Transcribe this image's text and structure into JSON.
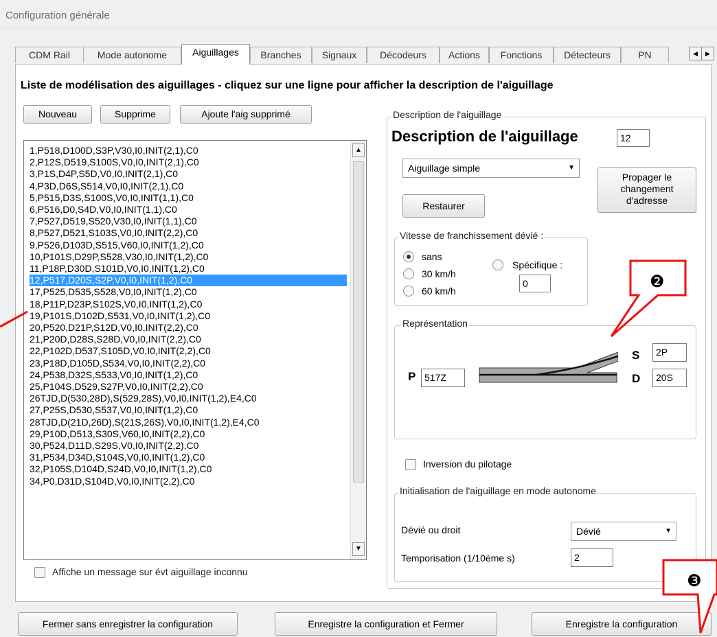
{
  "window": {
    "title": "Configuration générale"
  },
  "tabs": [
    {
      "label": "CDM Rail"
    },
    {
      "label": "Mode autonome"
    },
    {
      "label": "Aiguillages"
    },
    {
      "label": "Branches"
    },
    {
      "label": "Signaux"
    },
    {
      "label": "Décodeurs"
    },
    {
      "label": "Actions"
    },
    {
      "label": "Fonctions"
    },
    {
      "label": "Détecteurs"
    },
    {
      "label": "PN"
    }
  ],
  "active_tab": "Aiguillages",
  "heading": "Liste de modélisation des aiguillages - cliquez sur une ligne pour afficher la description de l'aiguillage",
  "list_toolbar": {
    "new_label": "Nouveau",
    "delete_label": "Supprime",
    "restore_label": "Ajoute l'aig supprimé"
  },
  "turnout_list": {
    "selected_index": 11,
    "items": [
      "1,P518,D100D,S3P,V30,I0,INIT(2,1),C0",
      "2,P12S,D519,S100S,V0,I0,INIT(2,1),C0",
      "3,P1S,D4P,S5D,V0,I0,INIT(2,1),C0",
      "4,P3D,D6S,S514,V0,I0,INIT(2,1),C0",
      "5,P515,D3S,S100S,V0,I0,INIT(1,1),C0",
      "6,P516,D0,S4D,V0,I0,INIT(1,1),C0",
      "7,P527,D519,S520,V30,I0,INIT(1,1),C0",
      "8,P527,D521,S103S,V0,I0,INIT(2,2),C0",
      "9,P526,D103D,S515,V60,I0,INIT(1,2),C0",
      "10,P101S,D29P,S528,V30,I0,INIT(1,2),C0",
      "11,P18P,D30D,S101D,V0,I0,INIT(1,2),C0",
      "12,P517,D20S,S2P,V0,I0,INIT(1,2),C0",
      "17,P525,D535,S528,V0,I0,INIT(1,2),C0",
      "18,P11P,D23P,S102S,V0,I0,INIT(1,2),C0",
      "19,P101S,D102D,S531,V0,I0,INIT(1,2),C0",
      "20,P520,D21P,S12D,V0,I0,INIT(2,2),C0",
      "21,P20D,D28S,S28D,V0,I0,INIT(2,2),C0",
      "22,P102D,D537,S105D,V0,I0,INIT(2,2),C0",
      "23,P18D,D105D,S534,V0,I0,INIT(2,2),C0",
      "24,P538,D32S,S533,V0,I0,INIT(1,2),C0",
      "25,P104S,D529,S27P,V0,I0,INIT(2,2),C0",
      "26TJD,D(530,28D),S(529,28S),V0,I0,INIT(1,2),E4,C0",
      "27,P25S,D530,S537,V0,I0,INIT(1,2),C0",
      "28TJD,D(21D,26D),S(21S,26S),V0,I0,INIT(1,2),E4,C0",
      "29,P10D,D513,S30S,V60,I0,INIT(2,2),C0",
      "30,P524,D11D,S29S,V0,I0,INIT(2,2),C0",
      "31,P534,D34D,S104S,V0,I0,INIT(1,2),C0",
      "32,P105S,D104D,S24D,V0,I0,INIT(1,2),C0",
      "34,P0,D31D,S104D,V0,I0,INIT(2,2),C0"
    ]
  },
  "unknown_event_checkbox": {
    "label": "Affiche un message sur évt aiguillage inconnu",
    "checked": false
  },
  "description": {
    "group_title": "Description de l'aiguillage",
    "title": "Description de l'aiguillage",
    "number": "12",
    "type_value": "Aiguillage simple",
    "propagate_label": [
      "Propager le",
      "changement",
      "d'adresse"
    ],
    "restore_label": "Restaurer",
    "speed": {
      "group_title": "Vitesse de franchissement dévié :",
      "options": [
        "sans",
        "30 km/h",
        "60 km/h"
      ],
      "selected": "sans",
      "specific_label": "Spécifique :",
      "specific_value": "0"
    },
    "representation": {
      "group_title": "Représentation",
      "p_label": "P",
      "p_value": "517Z",
      "s_label": "S",
      "s_value": "2P",
      "d_label": "D",
      "d_value": "20S"
    },
    "inversion_label": "Inversion du pilotage",
    "init": {
      "group_title": "Initialisation de l'aiguillage en mode autonome",
      "position_label": "Dévié ou droit",
      "position_value": "Dévié",
      "delay_label": "Temporisation  (1/10ème s)",
      "delay_value": "2"
    }
  },
  "callouts": {
    "c2": "❷",
    "c3": "❸"
  },
  "footer": {
    "close_no_save": "Fermer sans enregistrer la configuration",
    "save_close": "Enregistre la configuration et Fermer",
    "save": "Enregistre la configuration"
  },
  "colors": {
    "selection": "#3399ff",
    "callout": "#ee1111"
  }
}
